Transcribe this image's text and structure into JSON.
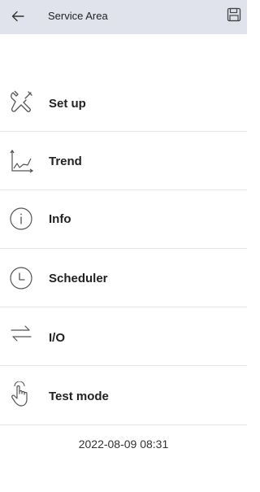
{
  "header": {
    "back_icon": "arrow-left-icon",
    "title": "Service Area",
    "save_icon": "floppy-disk-icon",
    "background": "#e1e3ec"
  },
  "menu": {
    "items": [
      {
        "label": "Set up",
        "icon": "tools-icon"
      },
      {
        "label": "Trend",
        "icon": "trend-chart-icon"
      },
      {
        "label": "Info",
        "icon": "info-icon"
      },
      {
        "label": "Scheduler",
        "icon": "clock-icon"
      },
      {
        "label": "I/O",
        "icon": "arrows-exchange-icon"
      },
      {
        "label": "Test mode",
        "icon": "hand-pointer-icon"
      }
    ]
  },
  "footer": {
    "datetime": "2022-08-09 08:31"
  }
}
